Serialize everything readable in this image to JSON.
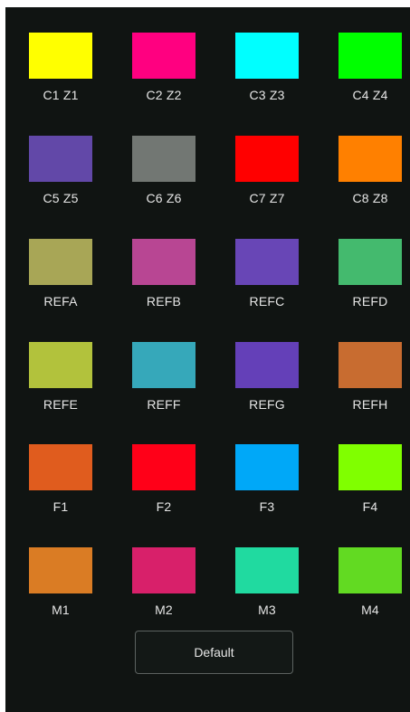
{
  "swatches": [
    {
      "label": "C1 Z1",
      "color": "#ffff00"
    },
    {
      "label": "C2 Z2",
      "color": "#ff0080"
    },
    {
      "label": "C3 Z3",
      "color": "#00ffff"
    },
    {
      "label": "C4 Z4",
      "color": "#00ff00"
    },
    {
      "label": "C5 Z5",
      "color": "#6248a8"
    },
    {
      "label": "C6 Z6",
      "color": "#727773"
    },
    {
      "label": "C7 Z7",
      "color": "#ff0000"
    },
    {
      "label": "C8 Z8",
      "color": "#ff8000"
    },
    {
      "label": "REFA",
      "color": "#a8a656"
    },
    {
      "label": "REFB",
      "color": "#b84693"
    },
    {
      "label": "REFC",
      "color": "#6846b6"
    },
    {
      "label": "REFD",
      "color": "#44ba6e"
    },
    {
      "label": "REFE",
      "color": "#b2c23c"
    },
    {
      "label": "REFF",
      "color": "#36a8ba"
    },
    {
      "label": "REFG",
      "color": "#6440b8"
    },
    {
      "label": "REFH",
      "color": "#c86c30"
    },
    {
      "label": "F1",
      "color": "#e05c1e"
    },
    {
      "label": "F2",
      "color": "#ff0018"
    },
    {
      "label": "F3",
      "color": "#00a8f8"
    },
    {
      "label": "F4",
      "color": "#80ff00"
    },
    {
      "label": "M1",
      "color": "#da7c24"
    },
    {
      "label": "M2",
      "color": "#d8206a"
    },
    {
      "label": "M3",
      "color": "#20daa0"
    },
    {
      "label": "M4",
      "color": "#62da22"
    }
  ],
  "default_button": {
    "label": "Default"
  },
  "theme": {
    "background": "#101412",
    "text": "#e6e6e6",
    "button_border": "#5c6260"
  }
}
